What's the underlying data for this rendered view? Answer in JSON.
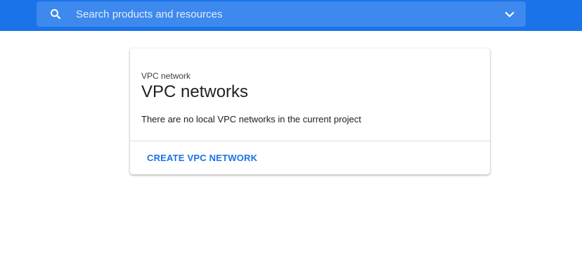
{
  "header": {
    "search": {
      "placeholder": "Search products and resources",
      "value": "",
      "icon": "search-icon",
      "expand_icon": "chevron-down-icon"
    },
    "bar_color": "#1a73e8"
  },
  "card": {
    "breadcrumb": "VPC network",
    "title": "VPC networks",
    "message": "There are no local VPC networks in the current project",
    "action_label": "CREATE VPC NETWORK",
    "accent_color": "#1a73e8"
  }
}
